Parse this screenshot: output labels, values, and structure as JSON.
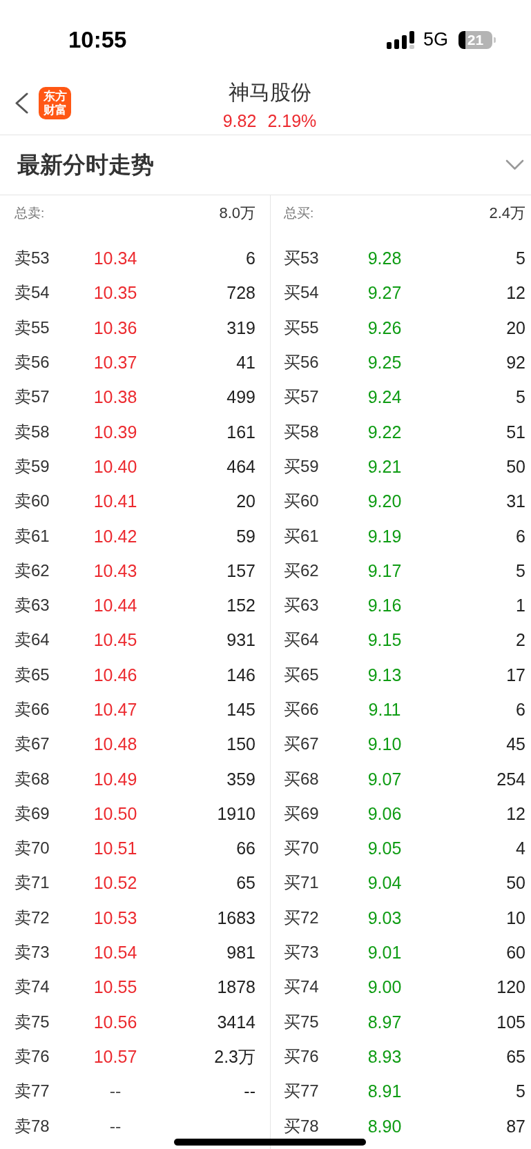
{
  "status_bar": {
    "time": "10:55",
    "network": "5G",
    "battery": "21"
  },
  "header": {
    "logo": "东方财富",
    "title": "神马股份",
    "price": "9.82",
    "change": "2.19%"
  },
  "section": {
    "title": "最新分时走势"
  },
  "sell": {
    "total_label": "总卖:",
    "total": "8.0万",
    "rows": [
      {
        "label": "卖53",
        "price": "10.34",
        "volume": "6",
        "color": "#ec2a2f"
      },
      {
        "label": "卖54",
        "price": "10.35",
        "volume": "728",
        "color": "#ec2a2f"
      },
      {
        "label": "卖55",
        "price": "10.36",
        "volume": "319",
        "color": "#ec2a2f"
      },
      {
        "label": "卖56",
        "price": "10.37",
        "volume": "41",
        "color": "#ec2a2f"
      },
      {
        "label": "卖57",
        "price": "10.38",
        "volume": "499",
        "color": "#ec2a2f"
      },
      {
        "label": "卖58",
        "price": "10.39",
        "volume": "161",
        "color": "#ec2a2f"
      },
      {
        "label": "卖59",
        "price": "10.40",
        "volume": "464",
        "color": "#ec2a2f"
      },
      {
        "label": "卖60",
        "price": "10.41",
        "volume": "20",
        "color": "#ec2a2f"
      },
      {
        "label": "卖61",
        "price": "10.42",
        "volume": "59",
        "color": "#ec2a2f"
      },
      {
        "label": "卖62",
        "price": "10.43",
        "volume": "157",
        "color": "#ec2a2f"
      },
      {
        "label": "卖63",
        "price": "10.44",
        "volume": "152",
        "color": "#ec2a2f"
      },
      {
        "label": "卖64",
        "price": "10.45",
        "volume": "931",
        "color": "#ec2a2f"
      },
      {
        "label": "卖65",
        "price": "10.46",
        "volume": "146",
        "color": "#ec2a2f"
      },
      {
        "label": "卖66",
        "price": "10.47",
        "volume": "145",
        "color": "#ec2a2f"
      },
      {
        "label": "卖67",
        "price": "10.48",
        "volume": "150",
        "color": "#ec2a2f"
      },
      {
        "label": "卖68",
        "price": "10.49",
        "volume": "359",
        "color": "#ec2a2f"
      },
      {
        "label": "卖69",
        "price": "10.50",
        "volume": "1910",
        "color": "#ec2a2f"
      },
      {
        "label": "卖70",
        "price": "10.51",
        "volume": "66",
        "color": "#ec2a2f"
      },
      {
        "label": "卖71",
        "price": "10.52",
        "volume": "65",
        "color": "#ec2a2f"
      },
      {
        "label": "卖72",
        "price": "10.53",
        "volume": "1683",
        "color": "#ec2a2f"
      },
      {
        "label": "卖73",
        "price": "10.54",
        "volume": "981",
        "color": "#ec2a2f"
      },
      {
        "label": "卖74",
        "price": "10.55",
        "volume": "1878",
        "color": "#ec2a2f"
      },
      {
        "label": "卖75",
        "price": "10.56",
        "volume": "3414",
        "color": "#ec2a2f"
      },
      {
        "label": "卖76",
        "price": "10.57",
        "volume": "2.3万",
        "color": "#ec2a2f"
      },
      {
        "label": "卖77",
        "price": "--",
        "volume": "--",
        "color": "#555555"
      },
      {
        "label": "卖78",
        "price": "--",
        "color": "#555555"
      }
    ]
  },
  "buy": {
    "total_label": "总买:",
    "total": "2.4万",
    "rows": [
      {
        "label": "买53",
        "price": "9.28",
        "volume": "5",
        "color": "#0f9c14"
      },
      {
        "label": "买54",
        "price": "9.27",
        "volume": "12",
        "color": "#0f9c14"
      },
      {
        "label": "买55",
        "price": "9.26",
        "volume": "20",
        "color": "#0f9c14"
      },
      {
        "label": "买56",
        "price": "9.25",
        "volume": "92",
        "color": "#0f9c14"
      },
      {
        "label": "买57",
        "price": "9.24",
        "volume": "5",
        "color": "#0f9c14"
      },
      {
        "label": "买58",
        "price": "9.22",
        "volume": "51",
        "color": "#0f9c14"
      },
      {
        "label": "买59",
        "price": "9.21",
        "volume": "50",
        "color": "#0f9c14"
      },
      {
        "label": "买60",
        "price": "9.20",
        "volume": "31",
        "color": "#0f9c14"
      },
      {
        "label": "买61",
        "price": "9.19",
        "volume": "6",
        "color": "#0f9c14"
      },
      {
        "label": "买62",
        "price": "9.17",
        "volume": "5",
        "color": "#0f9c14"
      },
      {
        "label": "买63",
        "price": "9.16",
        "volume": "1",
        "color": "#0f9c14"
      },
      {
        "label": "买64",
        "price": "9.15",
        "volume": "2",
        "color": "#0f9c14"
      },
      {
        "label": "买65",
        "price": "9.13",
        "volume": "17",
        "color": "#0f9c14"
      },
      {
        "label": "买66",
        "price": "9.11",
        "volume": "6",
        "color": "#0f9c14"
      },
      {
        "label": "买67",
        "price": "9.10",
        "volume": "45",
        "color": "#0f9c14"
      },
      {
        "label": "买68",
        "price": "9.07",
        "volume": "254",
        "color": "#0f9c14"
      },
      {
        "label": "买69",
        "price": "9.06",
        "volume": "12",
        "color": "#0f9c14"
      },
      {
        "label": "买70",
        "price": "9.05",
        "volume": "4",
        "color": "#0f9c14"
      },
      {
        "label": "买71",
        "price": "9.04",
        "volume": "50",
        "color": "#0f9c14"
      },
      {
        "label": "买72",
        "price": "9.03",
        "volume": "10",
        "color": "#0f9c14"
      },
      {
        "label": "买73",
        "price": "9.01",
        "volume": "60",
        "color": "#0f9c14"
      },
      {
        "label": "买74",
        "price": "9.00",
        "volume": "120",
        "color": "#0f9c14"
      },
      {
        "label": "买75",
        "price": "8.97",
        "volume": "105",
        "color": "#0f9c14"
      },
      {
        "label": "买76",
        "price": "8.93",
        "volume": "65",
        "color": "#0f9c14"
      },
      {
        "label": "买77",
        "price": "8.91",
        "volume": "5",
        "color": "#0f9c14"
      },
      {
        "label": "买78",
        "price": "8.90",
        "volume": "87",
        "color": "#0f9c14"
      }
    ]
  }
}
